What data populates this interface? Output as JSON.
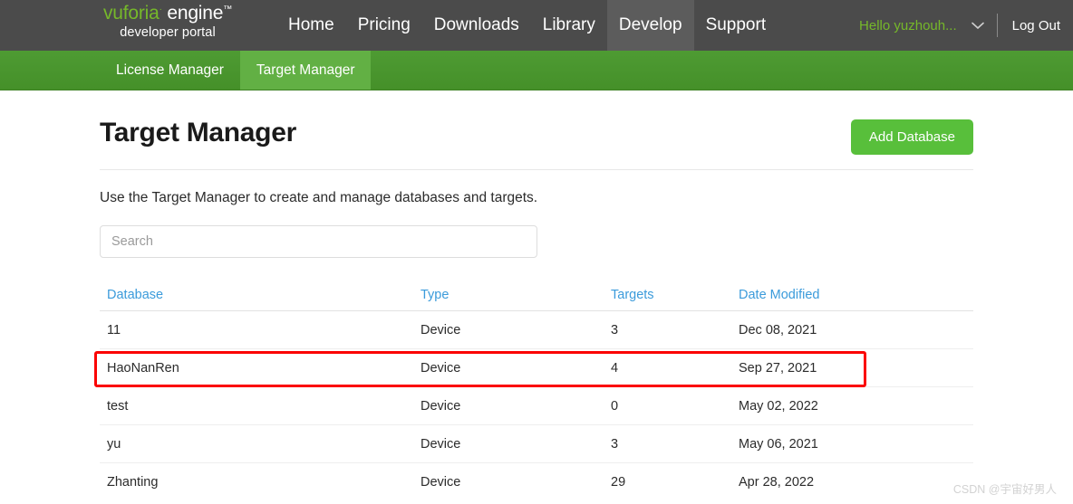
{
  "header": {
    "logo": {
      "brand": "vuforia",
      "product": "engine",
      "tagline": "developer portal",
      "trademark": "·",
      "trademark2": "™"
    },
    "nav_items": [
      {
        "label": "Home",
        "active": false
      },
      {
        "label": "Pricing",
        "active": false
      },
      {
        "label": "Downloads",
        "active": false
      },
      {
        "label": "Library",
        "active": false
      },
      {
        "label": "Develop",
        "active": true
      },
      {
        "label": "Support",
        "active": false
      }
    ],
    "user_greeting": "Hello yuzhouh...",
    "logout_label": "Log Out",
    "chevron_icon": "chevron-down-icon"
  },
  "subnav": {
    "items": [
      {
        "label": "License Manager",
        "active": false
      },
      {
        "label": "Target Manager",
        "active": true
      }
    ]
  },
  "page": {
    "title": "Target Manager",
    "add_button_label": "Add Database",
    "description": "Use the Target Manager to create and manage databases and targets."
  },
  "search": {
    "value": "",
    "placeholder": "Search"
  },
  "table": {
    "columns": [
      "Database",
      "Type",
      "Targets",
      "Date Modified"
    ],
    "rows": [
      {
        "database": "11",
        "type": "Device",
        "targets": "3",
        "date_modified": "Dec 08, 2021",
        "highlighted": false
      },
      {
        "database": "HaoNanRen",
        "type": "Device",
        "targets": "4",
        "date_modified": "Sep 27, 2021",
        "highlighted": false
      },
      {
        "database": "test",
        "type": "Device",
        "targets": "0",
        "date_modified": "May 02, 2022",
        "highlighted": true
      },
      {
        "database": "yu",
        "type": "Device",
        "targets": "3",
        "date_modified": "May 06, 2021",
        "highlighted": false
      },
      {
        "database": "Zhanting",
        "type": "Device",
        "targets": "29",
        "date_modified": "Apr 28, 2022",
        "highlighted": false
      }
    ]
  },
  "annotation": {
    "highlight_color": "#fb0303"
  },
  "watermark": {
    "text": "CSDN @宇宙好男人"
  },
  "colors": {
    "header_bg": "#4b4b4b",
    "subnav_bg": "#479a2c",
    "subnav_active": "#62b044",
    "brand_green": "#76b82a",
    "button_green": "#58bf3b",
    "link_blue": "#3b9bdb"
  }
}
